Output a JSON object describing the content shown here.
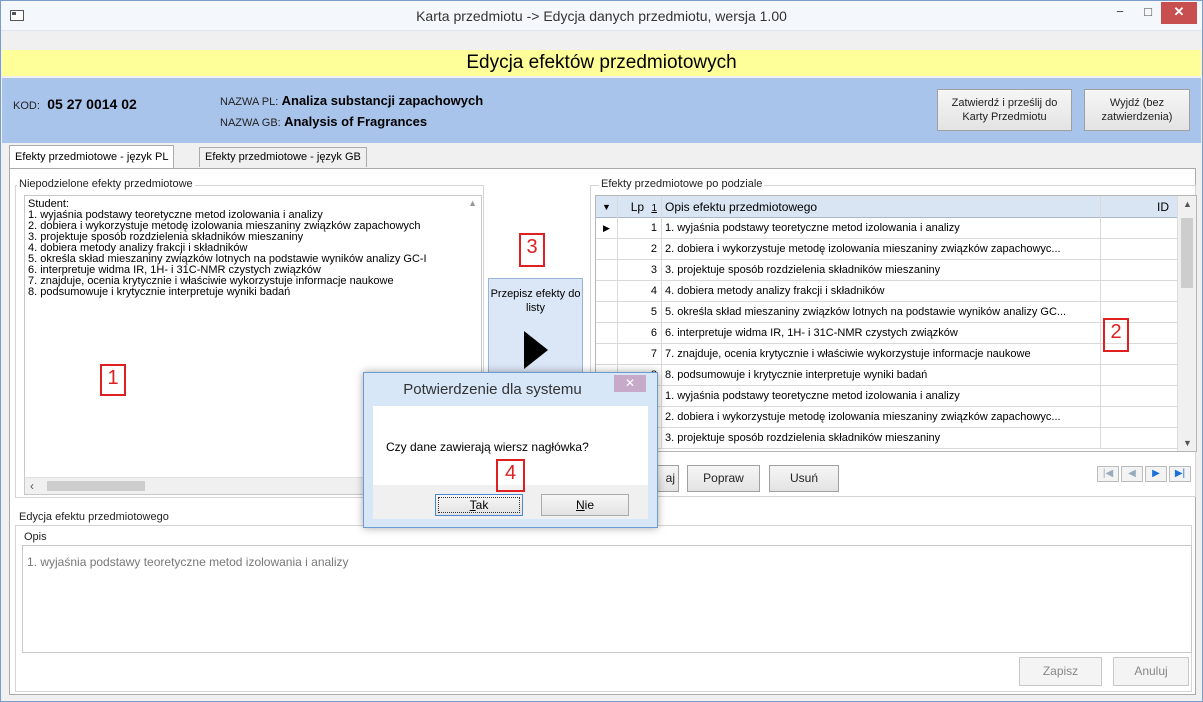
{
  "window": {
    "title": "Karta przedmiotu -> Edycja danych przedmiotu, wersja 1.00",
    "min_glyph": "−",
    "max_glyph": "□",
    "close_glyph": "✕"
  },
  "banner": "Edycja efektów przedmiotowych",
  "header": {
    "kod_label": "KOD:",
    "kod_value": "05 27 0014 02",
    "nazwa_pl_label": "NAZWA PL:",
    "nazwa_pl_value": "Analiza substancji zapachowych",
    "nazwa_gb_label": "NAZWA GB:",
    "nazwa_gb_value": "Analysis of Fragrances",
    "btn_zatwierdz": "Zatwierdź i prześlij do Karty Przedmiotu",
    "btn_wyjdz": "Wyjdź (bez zatwierdzenia)"
  },
  "tabs": [
    {
      "label": "Efekty przedmiotowe - język PL",
      "active": true
    },
    {
      "label": "Efekty przedmiotowe - język GB",
      "active": false
    }
  ],
  "left_group": {
    "title": "Niepodzielone efekty przedmiotowe",
    "lines": [
      "Student:",
      "1. wyjaśnia podstawy teoretyczne metod izolowania i analizy",
      "2. dobiera i wykorzystuje metodę izolowania mieszaniny związków zapachowych",
      "3. projektuje sposób rozdzielenia składników mieszaniny",
      "4. dobiera metody analizy  frakcji i składników",
      "5. określa skład mieszaniny związków lotnych na podstawie wyników analizy GC-I",
      "6. interpretuje widma IR, 1H- i 31C-NMR czystych związków",
      "7. znajduje, ocenia krytycznie i właściwie wykorzystuje informacje naukowe",
      "8. podsumowuje i krytycznie interpretuje wyniki badań"
    ]
  },
  "przepisz_button": "Przepisz efekty do listy",
  "right_group": {
    "title": "Efekty przedmiotowe po podziale",
    "columns": {
      "lp": "Lp",
      "sort": "1",
      "opis": "Opis efektu przedmiotowego",
      "id": "ID"
    },
    "rows": [
      {
        "lp": "1",
        "opis": "1. wyjaśnia podstawy teoretyczne metod izolowania i analizy"
      },
      {
        "lp": "2",
        "opis": "2. dobiera i wykorzystuje metodę izolowania mieszaniny związków zapachowyc..."
      },
      {
        "lp": "3",
        "opis": "3. projektuje sposób rozdzielenia składników mieszaniny"
      },
      {
        "lp": "4",
        "opis": "4. dobiera metody analizy  frakcji i składników"
      },
      {
        "lp": "5",
        "opis": "5. określa skład mieszaniny związków lotnych na podstawie wyników analizy GC..."
      },
      {
        "lp": "6",
        "opis": "6. interpretuje widma IR, 1H- i 31C-NMR czystych związków"
      },
      {
        "lp": "7",
        "opis": "7. znajduje, ocenia krytycznie i właściwie wykorzystuje informacje naukowe"
      },
      {
        "lp": "8",
        "opis": "8. podsumowuje i krytycznie interpretuje wyniki badań"
      },
      {
        "lp": "9",
        "opis": "1. wyjaśnia podstawy teoretyczne metod izolowania i analizy"
      },
      {
        "lp": "10",
        "opis": "2. dobiera i wykorzystuje metodę izolowania mieszaniny związków zapachowyc..."
      },
      {
        "lp": "11",
        "opis": "3. projektuje sposób rozdzielenia składników mieszaniny"
      }
    ],
    "btn_partial": "aj",
    "btn_popraw": "Popraw",
    "btn_usun": "Usuń"
  },
  "edit_group": {
    "title": "Edycja efektu przedmiotowego",
    "opis_label": "Opis",
    "opis_value": "1. wyjaśnia podstawy teoretyczne metod izolowania i analizy",
    "btn_zapisz": "Zapisz",
    "btn_anuluj": "Anuluj"
  },
  "annotations": [
    "1",
    "2",
    "3",
    "4"
  ],
  "dialog": {
    "title": "Potwierdzenie dla systemu",
    "message": "Czy dane zawierają wiersz nagłówka?",
    "btn_tak_u": "T",
    "btn_tak_rest": "ak",
    "btn_nie_u": "N",
    "btn_nie_rest": "ie"
  },
  "colors": {
    "banner": "#ffff99",
    "header": "#a9c4eb",
    "annotation": "#e02020"
  }
}
